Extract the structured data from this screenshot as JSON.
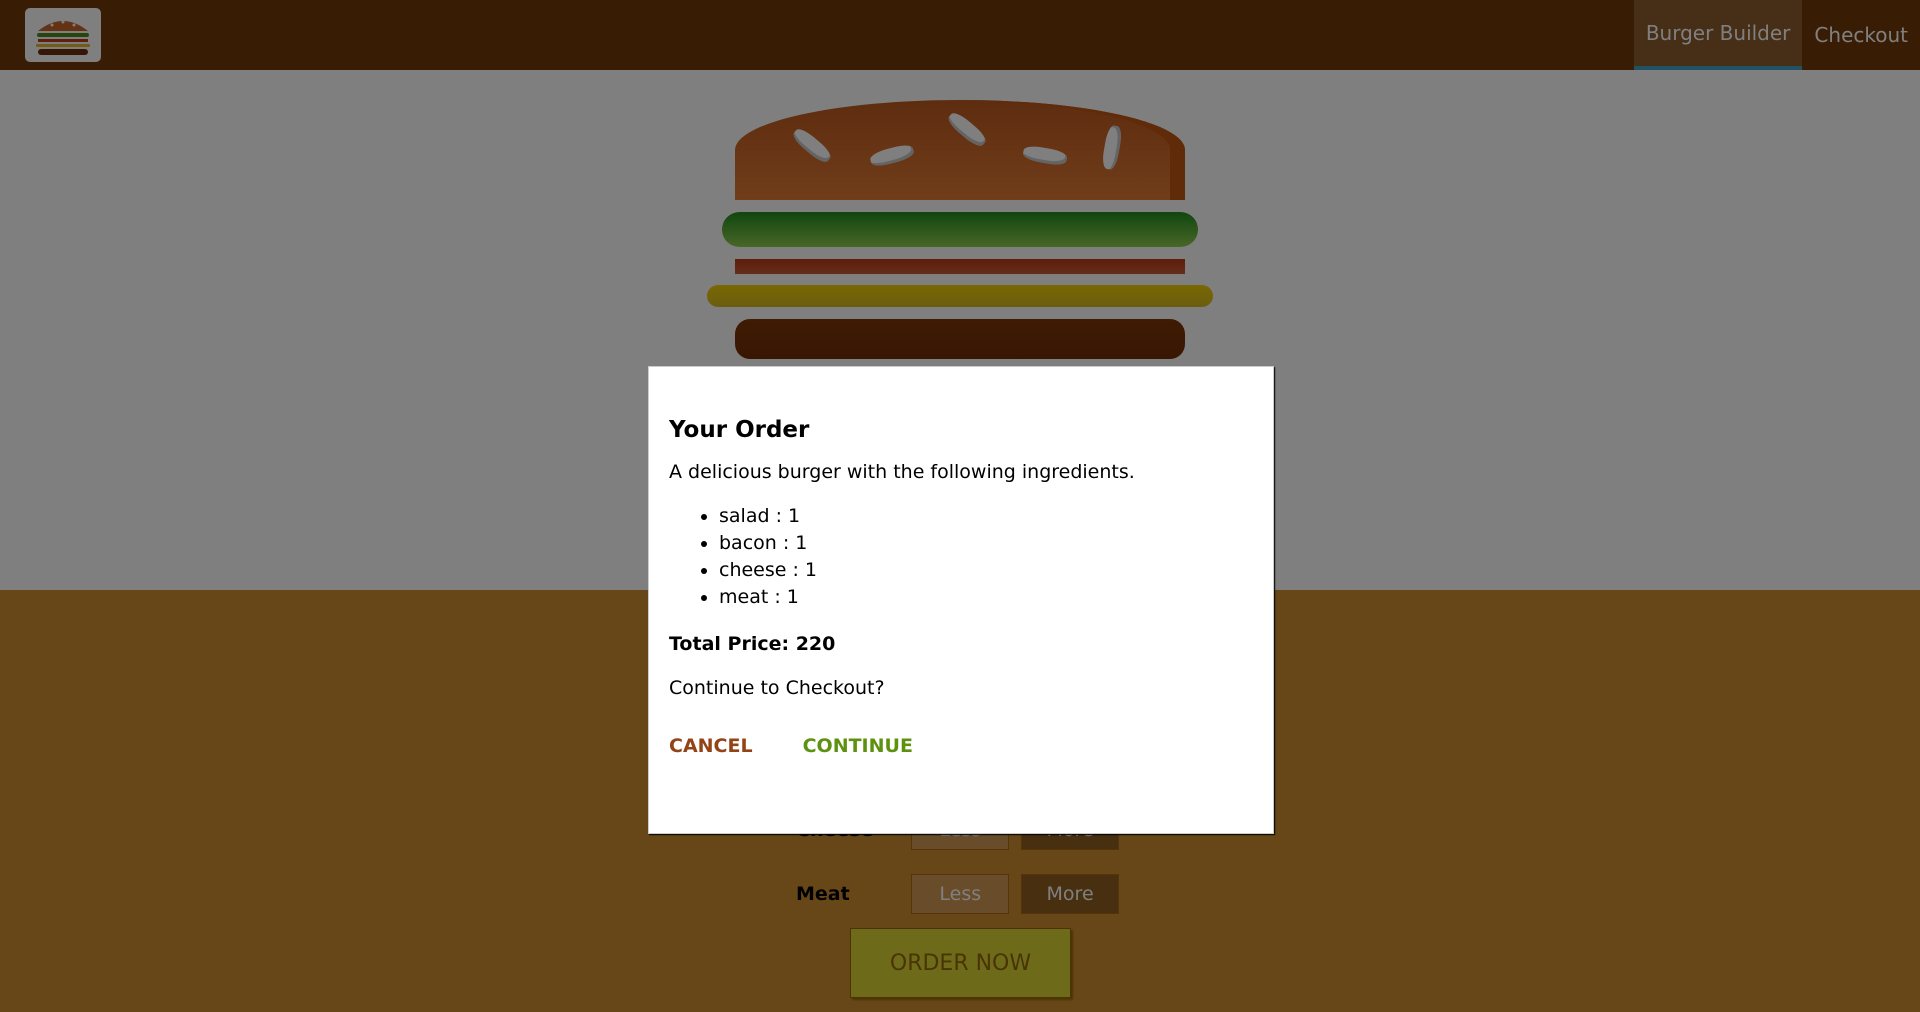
{
  "toolbar": {
    "logo_icon": "burger-logo-icon",
    "nav": [
      {
        "label": "Burger Builder",
        "active": true
      },
      {
        "label": "Checkout",
        "active": false
      }
    ]
  },
  "controls": [
    {
      "label": "Cheese",
      "less": "Less",
      "more": "More"
    },
    {
      "label": "Meat",
      "less": "Less",
      "more": "More"
    }
  ],
  "order_button": "ORDER NOW",
  "modal": {
    "title": "Your Order",
    "intro": "A delicious burger with the following ingredients.",
    "ingredients": [
      {
        "name": "salad",
        "count": "1",
        "text": "salad : 1"
      },
      {
        "name": "bacon",
        "count": "1",
        "text": "bacon : 1"
      },
      {
        "name": "cheese",
        "count": "1",
        "text": "cheese : 1"
      },
      {
        "name": "meat",
        "count": "1",
        "text": "meat : 1"
      }
    ],
    "total_price": "Total Price: 220",
    "question": "Continue to Checkout?",
    "cancel_label": "CANCEL",
    "continue_label": "CONTINUE"
  },
  "colors": {
    "toolbar": "#703B09",
    "controls_bg": "#CF8F2E",
    "cancel": "#944317",
    "continue": "#5C9210",
    "active_underline": "#40A4C8"
  }
}
